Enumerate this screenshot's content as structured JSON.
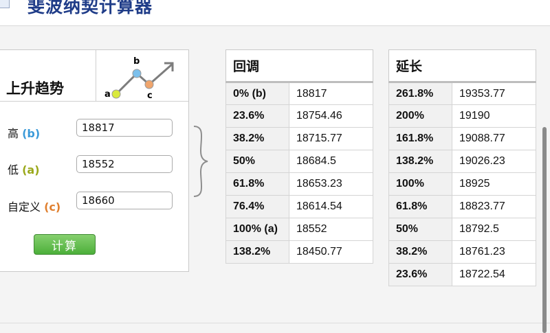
{
  "header": {
    "title": "斐波纳契计算器",
    "icon": "document-icon"
  },
  "trend": {
    "title": "上升趋势",
    "graphic": {
      "a": "a",
      "b": "b",
      "c": "c"
    }
  },
  "fields": [
    {
      "label": "高",
      "key": "(b)",
      "value": "18817",
      "key_color": "#3b9ad9"
    },
    {
      "label": "低",
      "key": "(a)",
      "value": "18552",
      "key_color": "#9aa81a"
    },
    {
      "label": "自定义",
      "key": "(c)",
      "value": "18660",
      "key_color": "#e07f2e"
    }
  ],
  "calculate_label": "计算",
  "retracement": {
    "title": "回调",
    "rows": [
      {
        "pct": "0% (b)",
        "value": "18817"
      },
      {
        "pct": "23.6%",
        "value": "18754.46"
      },
      {
        "pct": "38.2%",
        "value": "18715.77"
      },
      {
        "pct": "50%",
        "value": "18684.5"
      },
      {
        "pct": "61.8%",
        "value": "18653.23"
      },
      {
        "pct": "76.4%",
        "value": "18614.54"
      },
      {
        "pct": "100% (a)",
        "value": "18552"
      },
      {
        "pct": "138.2%",
        "value": "18450.77"
      }
    ]
  },
  "extension": {
    "title": "延长",
    "rows": [
      {
        "pct": "261.8%",
        "value": "19353.77"
      },
      {
        "pct": "200%",
        "value": "19190"
      },
      {
        "pct": "161.8%",
        "value": "19088.77"
      },
      {
        "pct": "138.2%",
        "value": "19026.23"
      },
      {
        "pct": "100%",
        "value": "18925"
      },
      {
        "pct": "61.8%",
        "value": "18823.77"
      },
      {
        "pct": "50%",
        "value": "18792.5"
      },
      {
        "pct": "38.2%",
        "value": "18761.23"
      },
      {
        "pct": "23.6%",
        "value": "18722.54"
      }
    ]
  },
  "colors": {
    "title": "#1f3c88",
    "button": "#4caf3a"
  }
}
